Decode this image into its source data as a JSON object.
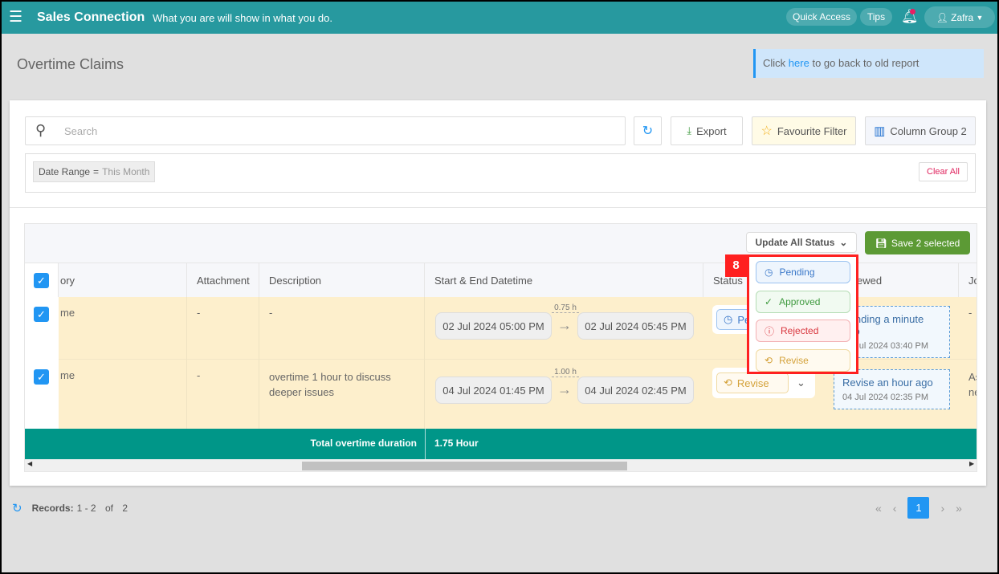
{
  "header": {
    "app_name": "Sales Connection",
    "tagline": "What you are will show in what you do.",
    "quick_access": "Quick Access",
    "tips": "Tips",
    "user": "Zafra"
  },
  "page": {
    "title": "Overtime Claims",
    "notice_pre": "Click",
    "notice_link": "here",
    "notice_post": "to go back to old report"
  },
  "toolbar": {
    "search_placeholder": "Search",
    "export": "Export",
    "favourite": "Favourite Filter",
    "column_group": "Column Group 2"
  },
  "filter": {
    "key": "Date Range",
    "op": "=",
    "value": "This Month",
    "clear": "Clear All"
  },
  "table_tools": {
    "update_all": "Update All Status",
    "save": "Save 2 selected"
  },
  "columns": [
    "ory",
    "Attachment",
    "Description",
    "Start & End Datetime",
    "Status",
    "Reviewed",
    "Jo"
  ],
  "rows": [
    {
      "category": "me",
      "attachment": "-",
      "description": "-",
      "start": "02 Jul 2024 05:00 PM",
      "end": "02 Jul 2024 05:45 PM",
      "duration": "0.75 h",
      "status": "Pending",
      "reviewed": "Pending a minute ago",
      "reviewed_at": "02 Jul 2024 03:40 PM",
      "jo": "-"
    },
    {
      "category": "me",
      "attachment": "-",
      "description": "overtime 1 hour to discuss deeper issues",
      "start": "04 Jul 2024 01:45 PM",
      "end": "04 Jul 2024 02:45 PM",
      "duration": "1.00 h",
      "status": "Revise",
      "reviewed": "Revise an hour ago",
      "reviewed_at": "04 Jul 2024 02:35 PM",
      "jo": "As ne"
    }
  ],
  "footer_row": {
    "label": "Total overtime duration",
    "value": "1.75 Hour"
  },
  "dropdown": {
    "badge": "8",
    "options": [
      {
        "label": "Pending",
        "color": "#3a78c9"
      },
      {
        "label": "Approved",
        "color": "#3f9a3f"
      },
      {
        "label": "Rejected",
        "color": "#d9363e"
      },
      {
        "label": "Revise",
        "color": "#d4a23a"
      }
    ]
  },
  "pager": {
    "records_label": "Records:",
    "range": "1 - 2",
    "of": "of",
    "total": "2",
    "current": "1"
  },
  "colors": {
    "header": "#27999f",
    "footer_row": "#009688",
    "save": "#5c9a35",
    "row_bg": "#fdefcc",
    "highlight": "#ff2020"
  }
}
